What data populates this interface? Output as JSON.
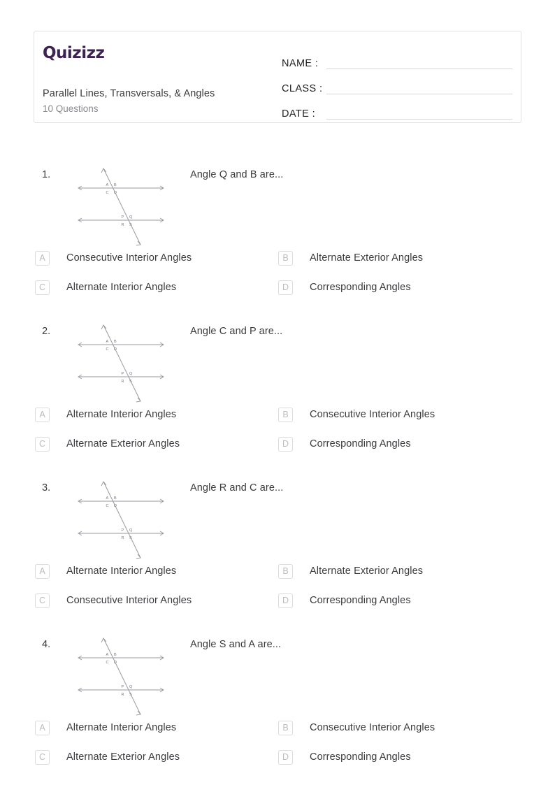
{
  "header": {
    "brand": "Quizizz",
    "title": "Parallel Lines, Transversals, & Angles",
    "subtitle": "10 Questions",
    "fields": [
      {
        "label": "NAME :"
      },
      {
        "label": "CLASS :"
      },
      {
        "label": "DATE  :"
      }
    ]
  },
  "figure": {
    "labels": [
      "A",
      "B",
      "C",
      "D",
      "P",
      "Q",
      "R",
      "S"
    ],
    "description": "two-parallel-lines-with-transversal"
  },
  "questions": [
    {
      "number": "1.",
      "prompt": "Angle Q and B are...",
      "options": [
        {
          "letter": "A",
          "label": "Consecutive Interior Angles"
        },
        {
          "letter": "B",
          "label": "Alternate Exterior Angles"
        },
        {
          "letter": "C",
          "label": "Alternate Interior Angles"
        },
        {
          "letter": "D",
          "label": "Corresponding Angles"
        }
      ]
    },
    {
      "number": "2.",
      "prompt": "Angle C and P are...",
      "options": [
        {
          "letter": "A",
          "label": "Alternate Interior Angles"
        },
        {
          "letter": "B",
          "label": "Consecutive Interior Angles"
        },
        {
          "letter": "C",
          "label": "Alternate Exterior Angles"
        },
        {
          "letter": "D",
          "label": "Corresponding Angles"
        }
      ]
    },
    {
      "number": "3.",
      "prompt": "Angle R and C are...",
      "options": [
        {
          "letter": "A",
          "label": "Alternate Interior Angles"
        },
        {
          "letter": "B",
          "label": "Alternate Exterior Angles"
        },
        {
          "letter": "C",
          "label": "Consecutive Interior Angles"
        },
        {
          "letter": "D",
          "label": "Corresponding Angles"
        }
      ]
    },
    {
      "number": "4.",
      "prompt": "Angle S and A are...",
      "options": [
        {
          "letter": "A",
          "label": "Alternate Interior Angles"
        },
        {
          "letter": "B",
          "label": "Consecutive Interior Angles"
        },
        {
          "letter": "C",
          "label": "Alternate Exterior Angles"
        },
        {
          "letter": "D",
          "label": "Corresponding Angles"
        }
      ]
    }
  ],
  "colors": {
    "brand": "#3d2352",
    "text": "#3b3b3f",
    "muted": "#8a8a90",
    "border": "#e2e2e6",
    "option_letter": "#bcbcc2",
    "figure_line": "#9a9aa0"
  }
}
